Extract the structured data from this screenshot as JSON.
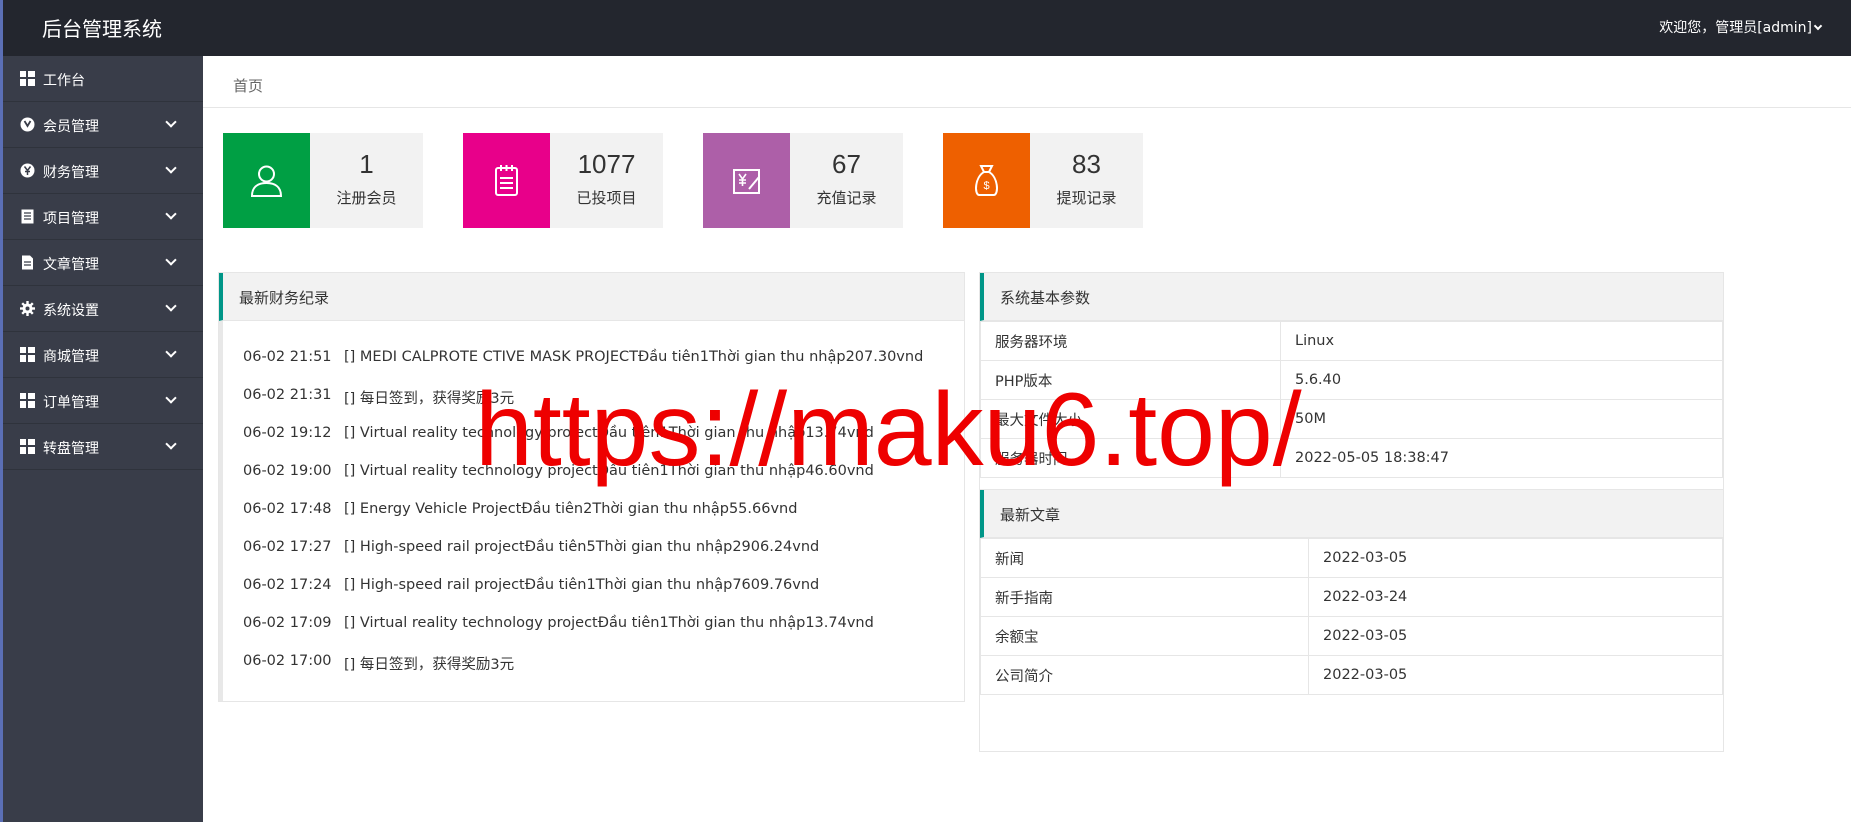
{
  "header": {
    "logo": "后台管理系统",
    "user_greeting": "欢迎您，管理员[admin]"
  },
  "sidebar": {
    "items": [
      {
        "label": "工作台",
        "icon": "dashboard-icon",
        "expandable": false
      },
      {
        "label": "会员管理",
        "icon": "member-icon",
        "expandable": true
      },
      {
        "label": "财务管理",
        "icon": "finance-icon",
        "expandable": true
      },
      {
        "label": "项目管理",
        "icon": "project-icon",
        "expandable": true
      },
      {
        "label": "文章管理",
        "icon": "article-icon",
        "expandable": true
      },
      {
        "label": "系统设置",
        "icon": "gear-icon",
        "expandable": true
      },
      {
        "label": "商城管理",
        "icon": "shop-icon",
        "expandable": true
      },
      {
        "label": "订单管理",
        "icon": "order-icon",
        "expandable": true
      },
      {
        "label": "转盘管理",
        "icon": "wheel-icon",
        "expandable": true
      }
    ]
  },
  "breadcrumb": "首页",
  "stats": [
    {
      "value": "1",
      "label": "注册会员",
      "color": "#009f44",
      "icon": "user-icon"
    },
    {
      "value": "1077",
      "label": "已投项目",
      "color": "#e8008a",
      "icon": "notepad-icon"
    },
    {
      "value": "67",
      "label": "充值记录",
      "color": "#ad5fa8",
      "icon": "recharge-icon"
    },
    {
      "value": "83",
      "label": "提现记录",
      "color": "#ee6000",
      "icon": "money-bag-icon"
    }
  ],
  "finance": {
    "title": "最新财务纪录",
    "rows": [
      {
        "time": "06-02 21:51",
        "desc": "[] MEDI CALPROTE CTIVE MASK PROJECTĐầu tiên1Thời gian thu nhập207.30vnd"
      },
      {
        "time": "06-02 21:31",
        "desc": "[] 每日签到，获得奖励3元"
      },
      {
        "time": "06-02 19:12",
        "desc": "[] Virtual reality technology projectĐầu tiên1Thời gian thu nhập13.74vnd"
      },
      {
        "time": "06-02 19:00",
        "desc": "[] Virtual reality technology projectĐầu tiên1Thời gian thu nhập46.60vnd"
      },
      {
        "time": "06-02 17:48",
        "desc": "[] Energy Vehicle ProjectĐầu tiên2Thời gian thu nhập55.66vnd"
      },
      {
        "time": "06-02 17:27",
        "desc": "[] High-speed rail projectĐầu tiên5Thời gian thu nhập2906.24vnd"
      },
      {
        "time": "06-02 17:24",
        "desc": "[] High-speed rail projectĐầu tiên1Thời gian thu nhập7609.76vnd"
      },
      {
        "time": "06-02 17:09",
        "desc": "[] Virtual reality technology projectĐầu tiên1Thời gian thu nhập13.74vnd"
      },
      {
        "time": "06-02 17:00",
        "desc": "[] 每日签到，获得奖励3元"
      }
    ]
  },
  "system": {
    "title": "系统基本参数",
    "rows": [
      {
        "key": "服务器环境",
        "value": "Linux"
      },
      {
        "key": "PHP版本",
        "value": "5.6.40"
      },
      {
        "key": "最大文件大小",
        "value": "50M"
      },
      {
        "key": "服务器时间",
        "value": "2022-05-05 18:38:47"
      }
    ]
  },
  "articles": {
    "title": "最新文章",
    "rows": [
      {
        "name": "新闻",
        "date": "2022-03-05"
      },
      {
        "name": "新手指南",
        "date": "2022-03-24"
      },
      {
        "name": "余额宝",
        "date": "2022-03-05"
      },
      {
        "name": "公司简介",
        "date": "2022-03-05"
      }
    ]
  },
  "watermark": "https://maku6.top/"
}
